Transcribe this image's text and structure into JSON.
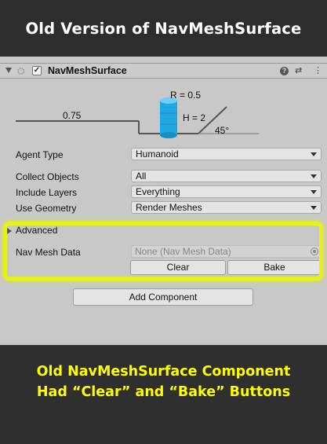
{
  "top_banner": {
    "title": "Old Version of NavMeshSurface"
  },
  "component": {
    "name": "NavMeshSurface",
    "enabled_mark": "✓",
    "header_icons": [
      "help-icon",
      "preset-icon",
      "more-icon"
    ],
    "help_glyph": "?",
    "preset_glyph": "⇄",
    "more_glyph": "⋮"
  },
  "diagram": {
    "step_height_label": "0.75",
    "radius_label": "R = 0.5",
    "height_label": "H = 2",
    "slope_label": "45°"
  },
  "properties": {
    "agent_type": {
      "label": "Agent Type",
      "value": "Humanoid"
    },
    "collect_objects": {
      "label": "Collect Objects",
      "value": "All"
    },
    "include_layers": {
      "label": "Include Layers",
      "value": "Everything"
    },
    "use_geometry": {
      "label": "Use Geometry",
      "value": "Render Meshes"
    }
  },
  "advanced": {
    "label": "Advanced"
  },
  "nav_mesh_data": {
    "label": "Nav Mesh Data",
    "value": "None (Nav Mesh Data)"
  },
  "buttons": {
    "clear": "Clear",
    "bake": "Bake",
    "add_component": "Add Component"
  },
  "bottom_banner": {
    "line1": "Old NavMeshSurface Component",
    "line2": "Had “Clear” and “Bake” Buttons"
  },
  "colors": {
    "highlight": "#e6f21a",
    "caption": "#ffff00",
    "cylinder": "#1ea7e0",
    "panel": "#c8c8c8"
  }
}
